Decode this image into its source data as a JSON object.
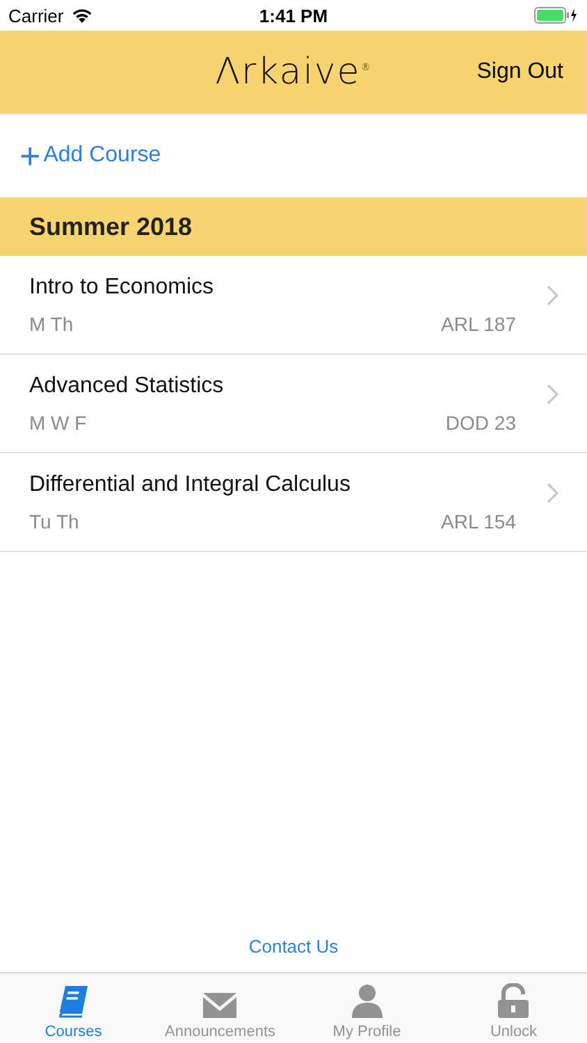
{
  "status_bar": {
    "carrier": "Carrier",
    "time": "1:41 PM"
  },
  "header": {
    "logo": "Λrkaive$^{®}$",
    "action": "Sign Out"
  },
  "add_course": {
    "icon": "+",
    "label": "Add Course"
  },
  "section": {
    "title": "Summer 2018"
  },
  "courses": [
    {
      "name": "Intro to Economics",
      "days": "M Th",
      "room": "ARL 187"
    },
    {
      "name": "Advanced Statistics",
      "days": "M W F",
      "room": "DOD 23"
    },
    {
      "name": "Differential and Integral Calculus",
      "days": "Tu Th",
      "room": "ARL 154"
    }
  ],
  "contact": "Contact Us",
  "tab_bar": [
    {
      "kind": "book",
      "label": "Courses",
      "selected": true
    },
    {
      "kind": "envelope",
      "label": "Announcements",
      "selected": false
    },
    {
      "kind": "person",
      "label": "My Profile",
      "selected": false
    },
    {
      "kind": "lock",
      "label": "Unlock",
      "selected": false
    }
  ]
}
